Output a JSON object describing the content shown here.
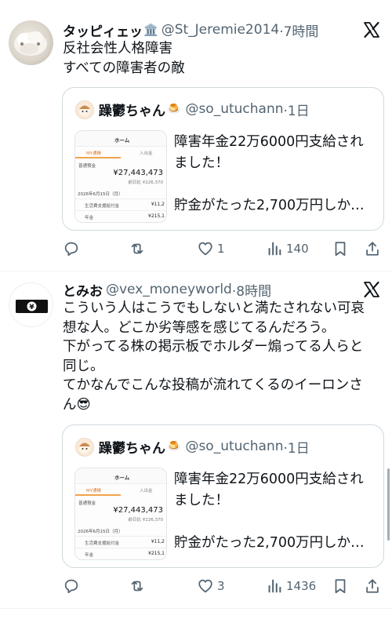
{
  "posts": [
    {
      "display_name": "タッピィェッ",
      "name_emoji": "🏛️",
      "handle": "@St_Jeremie2014",
      "time": "·7時間",
      "avatar_icon": "cotton-blob-avatar",
      "text_lines": [
        "反社会性人格障害",
        "すべての障害者の敵"
      ],
      "quote": {
        "name": "躁鬱ちゃん",
        "name_emoji": "🍮",
        "handle": "@so_utuchann",
        "time": "·1日",
        "text_lines": [
          "障害年金22万6000円支給され",
          "ました！",
          "",
          "貯金がたった2,700万円しか…"
        ],
        "thumbnail": {
          "header": "ホーム",
          "tab_left": "MY通帳",
          "tab_right": "入出金",
          "balance_label": "普通預金",
          "balance": "¥27,443,473",
          "change": "前日比 ¥226,370",
          "date": "2026年6月15日（月）",
          "row1_label": "生活費支援給付金",
          "row1_value": "¥11,2",
          "row2_label": "年金",
          "row2_value": "¥215,1"
        }
      },
      "actions": {
        "reply": "",
        "repost": "",
        "like": "1",
        "views": "140"
      }
    },
    {
      "display_name": "とみお",
      "name_emoji": "",
      "handle": "@vex_moneyworld",
      "time": "·8時間",
      "avatar_icon": "yen-banknote-avatar",
      "avatar_symbol": "¥",
      "text_lines": [
        "こういう人はこうでもしないと満たされない可哀",
        "想な人。どこか劣等感を感じてるんだろう。",
        "下がってる株の掲示板でホルダー煽ってる人らと",
        "同じ。",
        "てかなんでこんな投稿が流れてくるのイーロンさ",
        "ん😎"
      ],
      "quote": {
        "name": "躁鬱ちゃん",
        "name_emoji": "🍮",
        "handle": "@so_utuchann",
        "time": "·1日",
        "text_lines": [
          "障害年金22万6000円支給され",
          "ました！",
          "",
          "貯金がたった2,700万円しか…"
        ],
        "thumbnail": {
          "header": "ホーム",
          "tab_left": "MY通帳",
          "tab_right": "入出金",
          "balance_label": "普通預金",
          "balance": "¥27,443,473",
          "change": "前日比 ¥226,370",
          "date": "2026年6月15日（月）",
          "row1_label": "生活費支援給付金",
          "row1_value": "¥11,2",
          "row2_label": "年金",
          "row2_value": "¥215,1"
        }
      },
      "actions": {
        "reply": "",
        "repost": "",
        "like": "3",
        "views": "1436"
      }
    }
  ],
  "colors": {
    "text_primary": "#0f1419",
    "text_secondary": "#536471",
    "border": "#cfd9de",
    "divider": "#eff3f4"
  },
  "icons": {
    "platform": "x-logo-icon",
    "reply": "speech-bubble-icon",
    "repost": "repost-arrows-icon",
    "like": "heart-icon",
    "views": "bar-chart-icon",
    "bookmark": "bookmark-icon",
    "share": "share-upload-icon"
  }
}
